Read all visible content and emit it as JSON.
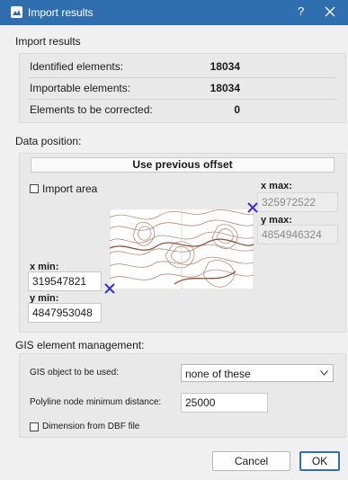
{
  "window": {
    "title": "Import results",
    "help_glyph": "?",
    "icon": "app-logo-icon",
    "accent": "#2f6fb0"
  },
  "import_results": {
    "section_label": "Import results",
    "rows": [
      {
        "label": "Identified elements:",
        "value": "18034"
      },
      {
        "label": "Importable elements:",
        "value": "18034"
      },
      {
        "label": "Elements to be corrected:",
        "value": "0"
      }
    ]
  },
  "data_position": {
    "section_label": "Data position:",
    "offset_button": "Use previous offset",
    "import_area_label": "Import area",
    "import_area_checked": false,
    "x_max_label": "x max:",
    "x_max_value": "325972522",
    "y_max_label": "y max:",
    "y_max_value": "4854946324",
    "x_min_label": "x min:",
    "x_min_value": "319547821",
    "y_min_label": "y min:",
    "y_min_value": "4847953048",
    "map_icon": "topographic-map-preview",
    "marker_color": "#3a2fbf",
    "contour_color": "#b88a78"
  },
  "gis": {
    "section_label": "GIS element management:",
    "object_label": "GIS object to be used:",
    "object_value": "none of these",
    "distance_label": "Polyline node minimum distance:",
    "distance_value": "25000",
    "dbf_label": "Dimension from DBF file",
    "dbf_checked": false
  },
  "footer": {
    "cancel_label": "Cancel",
    "ok_label": "OK"
  }
}
